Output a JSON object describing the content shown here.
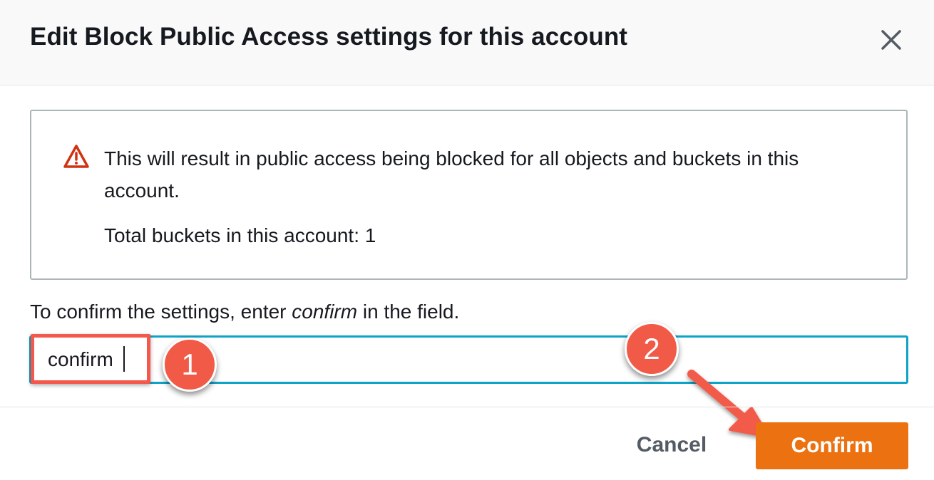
{
  "modal": {
    "title": "Edit Block Public Access settings for this account",
    "close_icon": "close-icon"
  },
  "alert": {
    "icon": "warning-triangle-icon",
    "message": "This will result in public access being blocked for all objects and buckets in this account.",
    "bucket_count_text": "Total buckets in this account: 1",
    "icon_color": "#d13212"
  },
  "confirmation": {
    "label_before": "To confirm the settings, enter ",
    "label_keyword": "confirm",
    "label_after": " in the field.",
    "input_value": "confirm"
  },
  "annotations": {
    "step_1": "1",
    "step_2": "2",
    "highlight_color": "#f4574b"
  },
  "footer": {
    "cancel_label": "Cancel",
    "confirm_label": "Confirm",
    "confirm_color": "#ec7211"
  }
}
